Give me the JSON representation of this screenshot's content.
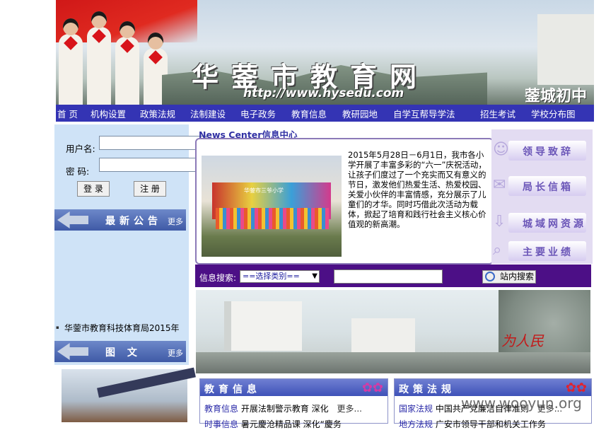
{
  "banner": {
    "title": "华蓥市教育网",
    "url": "http://www.hysedu.com",
    "school": "蓥城初中"
  },
  "nav": {
    "items": [
      "首 页",
      "机构设置",
      "政策法规",
      "法制建设",
      "电子政务",
      "教育信息",
      "教研园地",
      "自学互帮导学法",
      "招生考试",
      "学校分布图"
    ]
  },
  "login": {
    "username_label": "用户名:",
    "password_label": "密  码:",
    "login_button": "登 录",
    "register_button": "注 册"
  },
  "notice_bar": {
    "title": "最新公告",
    "more": "更多"
  },
  "notice_item": "华蓥市教育科技体育局2015年",
  "photo_bar": {
    "title": "图  文",
    "more": "更多"
  },
  "news_center": {
    "title": "News Center信息中心",
    "photo_banner": "华蓥市三爷小学",
    "text": "2015年5月28日－6月1日，我市各小学开展了丰富多彩的“六一”庆祝活动，让孩子们度过了一个充实而又有意义的节日，激发他们热爱生活、热爱校园、关爱小伙伴的丰富情感，充分展示了儿童们的才华。同时巧借此次活动为载体，掀起了培育和践行社会主义核心价值观的新高潮。"
  },
  "right_links": [
    "领导致辞",
    "局长信箱",
    "城域网资源",
    "主要业绩"
  ],
  "search": {
    "label": "信息搜索:",
    "select_value": "==选择类别==",
    "button": "站内搜索"
  },
  "city_photo": {
    "signature": "为人民"
  },
  "edu_info": {
    "title": "教育信息",
    "rows": [
      {
        "cat": "教育信息",
        "text": "开展法制警示教育 深化",
        "more": "更多..."
      },
      {
        "cat": "时事信息",
        "text": "暑元慶沧精品课 深化“慶务",
        "more": ""
      }
    ]
  },
  "policy": {
    "title": "政策法规",
    "rows": [
      {
        "cat": "国家法规",
        "text": "中国共产党廉洁自律准则",
        "more": "更多..."
      },
      {
        "cat": "地方法规",
        "text": "广安市领导干部和机关工作务",
        "more": ""
      }
    ]
  },
  "watermark": "www.wooyun.org"
}
